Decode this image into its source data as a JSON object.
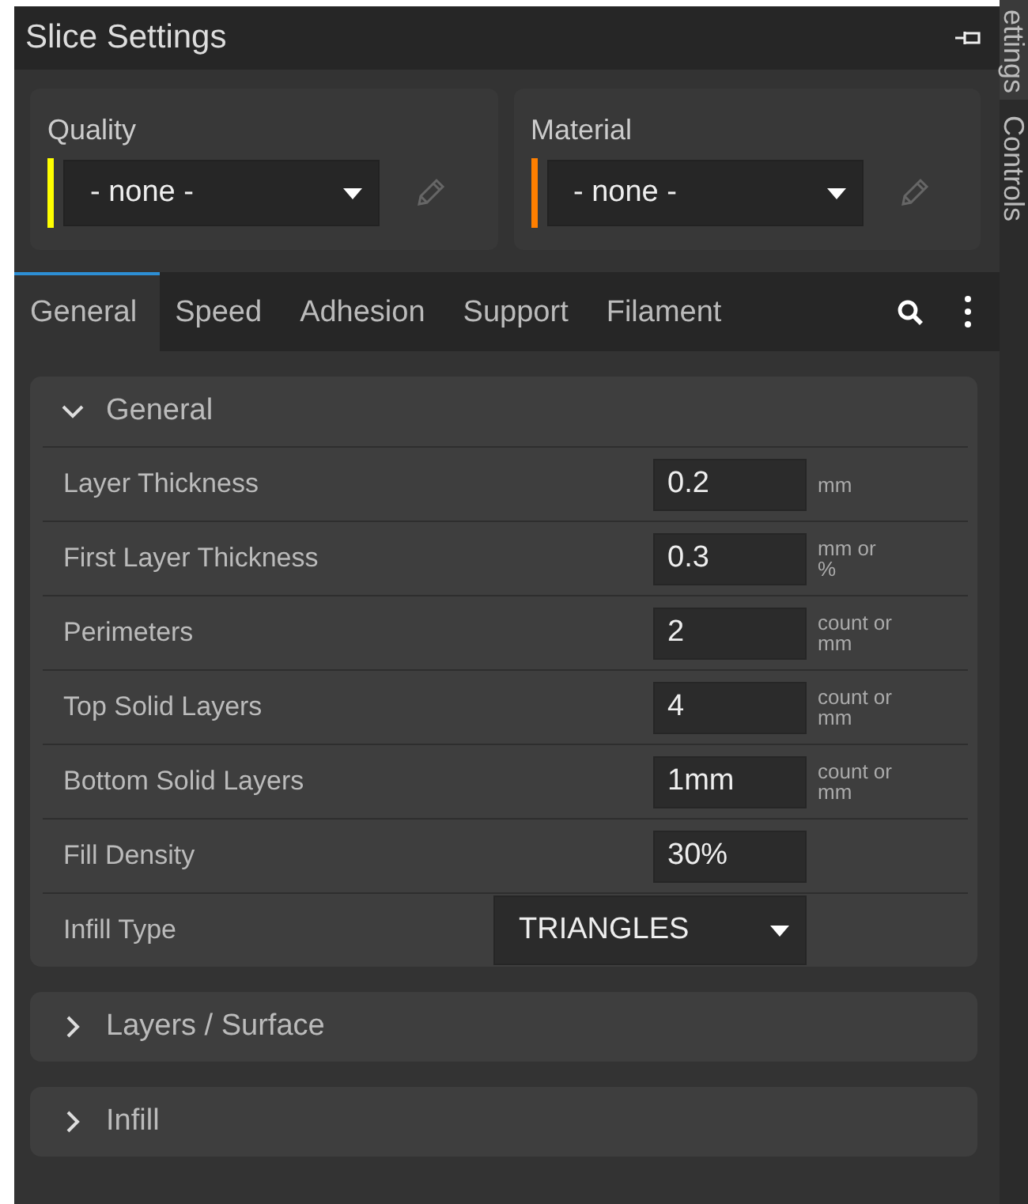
{
  "panel": {
    "title": "Slice Settings"
  },
  "side_tabs": [
    {
      "label": "ettings",
      "selected": true
    },
    {
      "label": "Controls",
      "selected": false
    }
  ],
  "presets": [
    {
      "label": "Quality",
      "value": "- none -",
      "color": "#ffff00"
    },
    {
      "label": "Material",
      "value": "- none -",
      "color": "#ff7f00"
    }
  ],
  "tabs": [
    {
      "label": "General",
      "selected": true
    },
    {
      "label": "Speed",
      "selected": false
    },
    {
      "label": "Adhesion",
      "selected": false
    },
    {
      "label": "Support",
      "selected": false
    },
    {
      "label": "Filament",
      "selected": false
    }
  ],
  "sections": [
    {
      "title": "General",
      "expanded": true,
      "settings": [
        {
          "label": "Layer Thickness",
          "kind": "input",
          "value": "0.2",
          "unit": "mm"
        },
        {
          "label": "First Layer Thickness",
          "kind": "input",
          "value": "0.3",
          "unit": "mm or %"
        },
        {
          "label": "Perimeters",
          "kind": "input",
          "value": "2",
          "unit": "count or mm"
        },
        {
          "label": "Top Solid Layers",
          "kind": "input",
          "value": "4",
          "unit": "count or mm"
        },
        {
          "label": "Bottom Solid Layers",
          "kind": "input",
          "value": "1mm",
          "unit": "count or mm"
        },
        {
          "label": "Fill Density",
          "kind": "input",
          "value": "30%"
        },
        {
          "label": "Infill Type",
          "kind": "select",
          "value": "TRIANGLES"
        }
      ]
    },
    {
      "title": "Layers / Surface",
      "expanded": false
    },
    {
      "title": "Infill",
      "expanded": false
    }
  ]
}
